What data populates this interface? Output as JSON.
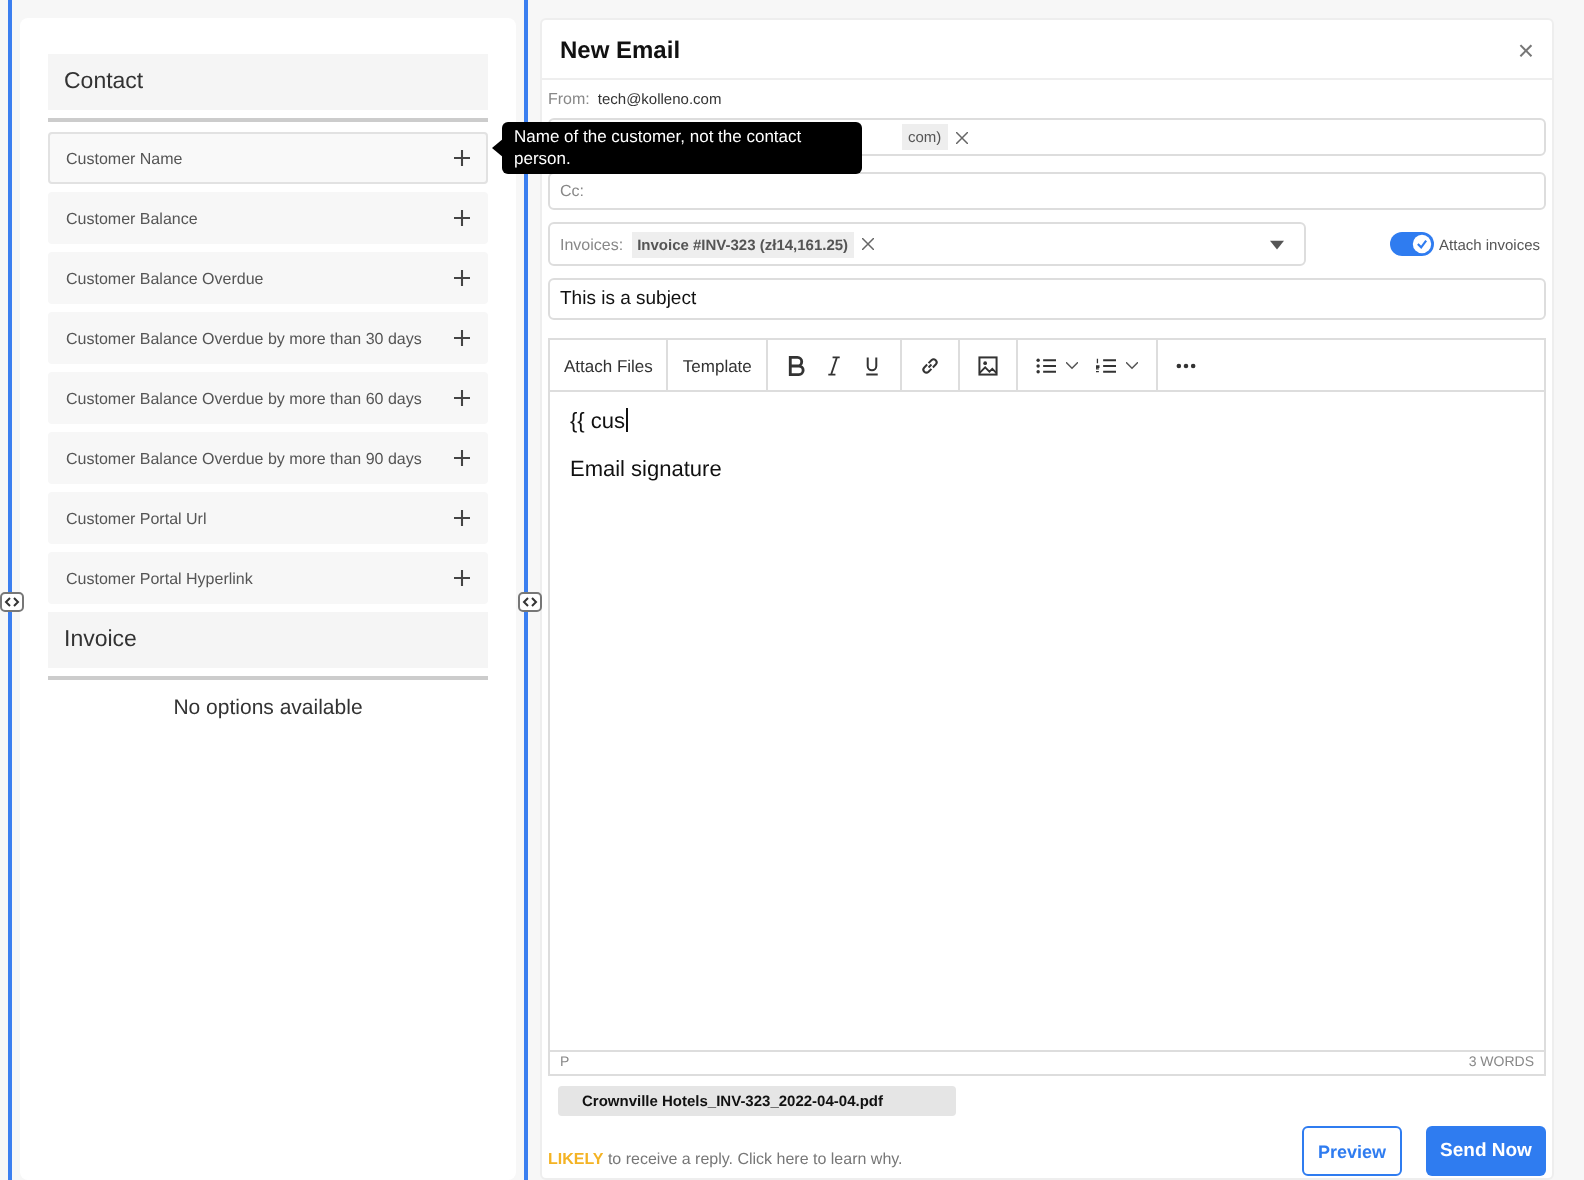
{
  "variables": {
    "groups": [
      {
        "title": "Contact",
        "items": [
          {
            "label": "Customer Name",
            "hovered": true
          },
          {
            "label": "Customer Balance",
            "hovered": false
          },
          {
            "label": "Customer Balance Overdue",
            "hovered": false
          },
          {
            "label": "Customer Balance Overdue by more than 30 days",
            "hovered": false
          },
          {
            "label": "Customer Balance Overdue by more than 60 days",
            "hovered": false
          },
          {
            "label": "Customer Balance Overdue by more than 90 days",
            "hovered": false
          },
          {
            "label": "Customer Portal Url",
            "hovered": false
          },
          {
            "label": "Customer Portal Hyperlink",
            "hovered": false
          }
        ]
      },
      {
        "title": "Invoice",
        "empty_text": "No options available"
      }
    ]
  },
  "tooltip": {
    "text": "Name of the customer, not the contact person."
  },
  "email": {
    "title": "New Email",
    "close": "×",
    "from_label": "From:",
    "from_value": "tech@kolleno.com",
    "to_chip": "com)",
    "cc_label": "Cc:",
    "invoices_label": "Invoices:",
    "invoice_chip": "Invoice #INV-323 (zł14,161.25)",
    "attach_invoices": {
      "label": "Attach invoices",
      "on": true
    },
    "subject": "This is a subject",
    "toolbar": [
      "Attach Files",
      "Template"
    ],
    "body": [
      "{{ cus",
      "Email signature"
    ],
    "status_left": "P",
    "word_count": "3 WORDS",
    "attachment": "Crownville Hotels_INV-323_2022-04-04.pdf",
    "likelihood": "LIKELY",
    "likelihood_text": "to receive a reply. Click here to learn why.",
    "buttons": [
      "Preview",
      "Send Now"
    ]
  }
}
